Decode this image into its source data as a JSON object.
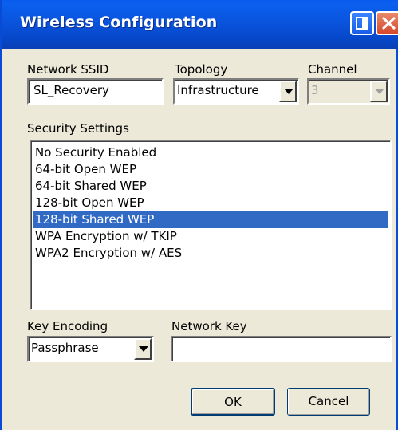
{
  "window": {
    "title": "Wireless Configuration",
    "title_buttons": [
      "help-icon",
      "close-icon"
    ]
  },
  "ssid": {
    "label": "Network SSID",
    "value": "SL_Recovery"
  },
  "topology": {
    "label": "Topology",
    "value": "Infrastructure"
  },
  "channel": {
    "label": "Channel",
    "value": "3",
    "enabled": false
  },
  "security": {
    "label": "Security Settings",
    "items": [
      {
        "label": "No Security Enabled"
      },
      {
        "label": "64-bit Open WEP"
      },
      {
        "label": "64-bit Shared WEP"
      },
      {
        "label": "128-bit Open WEP"
      },
      {
        "label": "128-bit Shared WEP",
        "selected": true
      },
      {
        "label": "WPA Encryption w/ TKIP"
      },
      {
        "label": "WPA2 Encryption w/ AES"
      }
    ],
    "selection_color": "#316ac5"
  },
  "key_encoding": {
    "label": "Key Encoding",
    "value": "Passphrase"
  },
  "network_key": {
    "label": "Network Key",
    "value": ""
  },
  "buttons": {
    "ok": "OK",
    "cancel": "Cancel"
  },
  "colors": {
    "titlebar": "#0a55e0",
    "dialog_bg": "#ece9d8"
  }
}
